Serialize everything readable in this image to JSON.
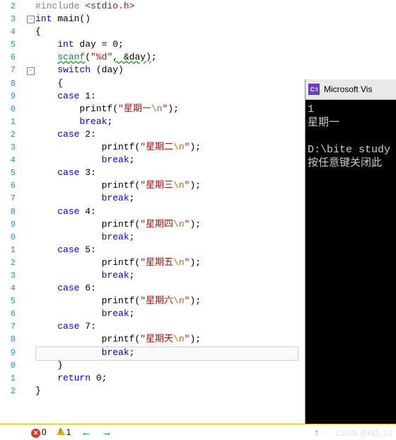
{
  "chart_data": null,
  "editor": {
    "first_line_no": 2,
    "selection_row_index": 27,
    "lines": {
      "l0": [
        {
          "c": "pp",
          "t": "#include "
        },
        {
          "c": "inc",
          "t": "<stdio.h>"
        }
      ],
      "l1": [
        {
          "c": "kw",
          "t": "int"
        },
        {
          "c": "punc",
          "t": " main()"
        }
      ],
      "l2": [
        {
          "c": "punc",
          "t": "{"
        }
      ],
      "l3": [
        {
          "c": "punc",
          "t": "    "
        },
        {
          "c": "kw",
          "t": "int"
        },
        {
          "c": "punc",
          "t": " day = 0;"
        }
      ],
      "l4": [
        {
          "c": "punc",
          "t": "    "
        },
        {
          "c": "green wavy",
          "t": "scanf"
        },
        {
          "c": "punc",
          "t": "("
        },
        {
          "c": "str",
          "t": "\"%d\""
        },
        {
          "c": "punc wavy",
          "t": ", &day)"
        },
        {
          "c": "punc",
          "t": ";"
        }
      ],
      "l5": [
        {
          "c": "punc",
          "t": "    "
        },
        {
          "c": "kw",
          "t": "switch"
        },
        {
          "c": "punc",
          "t": " (day)"
        }
      ],
      "l6": [
        {
          "c": "punc",
          "t": "    {"
        }
      ],
      "l7": [
        {
          "c": "punc",
          "t": "    "
        },
        {
          "c": "kw",
          "t": "case"
        },
        {
          "c": "punc",
          "t": " 1:"
        }
      ],
      "l8": [
        {
          "c": "punc",
          "t": "        printf("
        },
        {
          "c": "str",
          "t": "\"星期一"
        },
        {
          "c": "esc",
          "t": "\\n"
        },
        {
          "c": "str",
          "t": "\""
        },
        {
          "c": "punc",
          "t": ");"
        }
      ],
      "l9": [
        {
          "c": "punc",
          "t": "        "
        },
        {
          "c": "kw",
          "t": "break"
        },
        {
          "c": "punc",
          "t": ";"
        }
      ],
      "l10": [
        {
          "c": "punc",
          "t": "    "
        },
        {
          "c": "kw",
          "t": "case"
        },
        {
          "c": "punc",
          "t": " 2:"
        }
      ],
      "l11": [
        {
          "c": "punc",
          "t": "            printf("
        },
        {
          "c": "str",
          "t": "\"星期二"
        },
        {
          "c": "esc",
          "t": "\\n"
        },
        {
          "c": "str",
          "t": "\""
        },
        {
          "c": "punc",
          "t": ");"
        }
      ],
      "l12": [
        {
          "c": "punc",
          "t": "            "
        },
        {
          "c": "kw",
          "t": "break"
        },
        {
          "c": "punc",
          "t": ";"
        }
      ],
      "l13": [
        {
          "c": "punc",
          "t": "    "
        },
        {
          "c": "kw",
          "t": "case"
        },
        {
          "c": "punc",
          "t": " 3:"
        }
      ],
      "l14": [
        {
          "c": "punc",
          "t": "            printf("
        },
        {
          "c": "str",
          "t": "\"星期三"
        },
        {
          "c": "esc",
          "t": "\\n"
        },
        {
          "c": "str",
          "t": "\""
        },
        {
          "c": "punc",
          "t": ");"
        }
      ],
      "l15": [
        {
          "c": "punc",
          "t": "            "
        },
        {
          "c": "kw",
          "t": "break"
        },
        {
          "c": "punc",
          "t": ";"
        }
      ],
      "l16": [
        {
          "c": "punc",
          "t": "    "
        },
        {
          "c": "kw",
          "t": "case"
        },
        {
          "c": "punc",
          "t": " 4:"
        }
      ],
      "l17": [
        {
          "c": "punc",
          "t": "            printf("
        },
        {
          "c": "str",
          "t": "\"星期四"
        },
        {
          "c": "esc",
          "t": "\\n"
        },
        {
          "c": "str",
          "t": "\""
        },
        {
          "c": "punc",
          "t": ");"
        }
      ],
      "l18": [
        {
          "c": "punc",
          "t": "            "
        },
        {
          "c": "kw",
          "t": "break"
        },
        {
          "c": "punc",
          "t": ";"
        }
      ],
      "l19": [
        {
          "c": "punc",
          "t": "    "
        },
        {
          "c": "kw",
          "t": "case"
        },
        {
          "c": "punc",
          "t": " 5:"
        }
      ],
      "l20": [
        {
          "c": "punc",
          "t": "            printf("
        },
        {
          "c": "str",
          "t": "\"星期五"
        },
        {
          "c": "esc",
          "t": "\\n"
        },
        {
          "c": "str",
          "t": "\""
        },
        {
          "c": "punc",
          "t": ");"
        }
      ],
      "l21": [
        {
          "c": "punc",
          "t": "            "
        },
        {
          "c": "kw",
          "t": "break"
        },
        {
          "c": "punc",
          "t": ";"
        }
      ],
      "l22": [
        {
          "c": "punc",
          "t": "    "
        },
        {
          "c": "kw",
          "t": "case"
        },
        {
          "c": "punc",
          "t": " 6:"
        }
      ],
      "l23": [
        {
          "c": "punc",
          "t": "            printf("
        },
        {
          "c": "str",
          "t": "\"星期六"
        },
        {
          "c": "esc",
          "t": "\\n"
        },
        {
          "c": "str",
          "t": "\""
        },
        {
          "c": "punc",
          "t": ");"
        }
      ],
      "l24": [
        {
          "c": "punc",
          "t": "            "
        },
        {
          "c": "kw",
          "t": "break"
        },
        {
          "c": "punc",
          "t": ";"
        }
      ],
      "l25": [
        {
          "c": "punc",
          "t": "    "
        },
        {
          "c": "kw",
          "t": "case"
        },
        {
          "c": "punc",
          "t": " 7:"
        }
      ],
      "l26": [
        {
          "c": "punc",
          "t": "            printf("
        },
        {
          "c": "str",
          "t": "\"星期天"
        },
        {
          "c": "esc",
          "t": "\\n"
        },
        {
          "c": "str",
          "t": "\""
        },
        {
          "c": "punc",
          "t": ");"
        }
      ],
      "l27": [
        {
          "c": "punc",
          "t": "            "
        },
        {
          "c": "kw",
          "t": "break"
        },
        {
          "c": "punc",
          "t": ";"
        }
      ],
      "l28": [
        {
          "c": "punc",
          "t": "    }"
        }
      ],
      "l29": [
        {
          "c": "punc",
          "t": "    "
        },
        {
          "c": "kw",
          "t": "return"
        },
        {
          "c": "punc",
          "t": " 0;"
        }
      ],
      "l30": [
        {
          "c": "punc",
          "t": "}"
        }
      ]
    },
    "fold_rows": [
      1,
      5
    ]
  },
  "console": {
    "title": "Microsoft Vis",
    "icon_label": "C:\\",
    "lines": [
      "1",
      "星期一",
      "",
      "D:\\bite study",
      "按任意键关闭此"
    ]
  },
  "statusbar": {
    "errors": "0",
    "warnings": "1",
    "uparrow": "↑",
    "back": "←",
    "fwd": "→"
  },
  "watermark": "CSDN @HD_13"
}
